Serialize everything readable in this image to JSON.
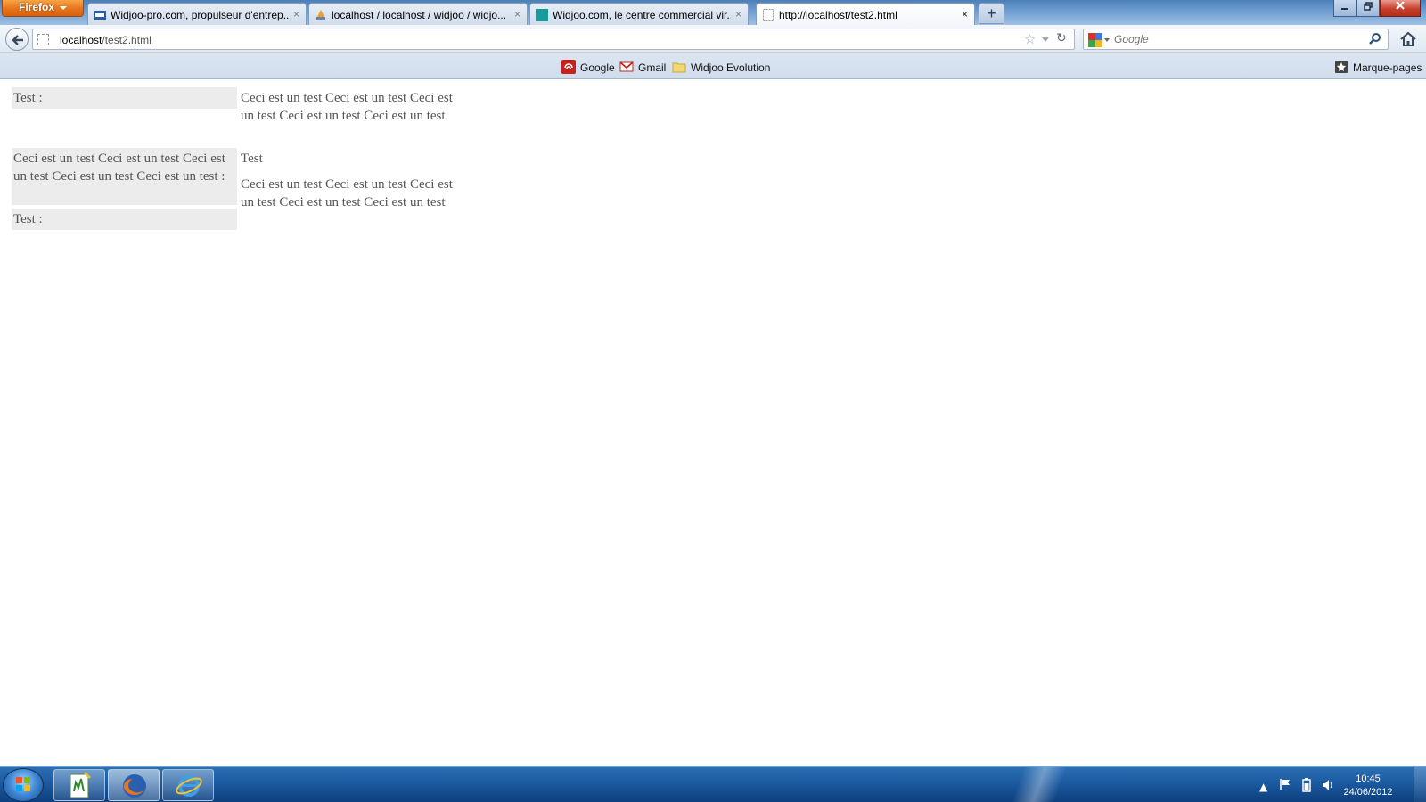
{
  "browser": {
    "menu_button": "Firefox",
    "tabs": [
      {
        "title": "Widjoo-pro.com, propulseur d'entrep...",
        "favicon": "pro-icon"
      },
      {
        "title": "localhost / localhost / widjoo / widjo...",
        "favicon": "phpmyadmin-icon"
      },
      {
        "title": "Widjoo.com, le centre commercial vir...",
        "favicon": "teal-square-icon"
      },
      {
        "title": "http://localhost/test2.html",
        "favicon": "blank-page-icon"
      }
    ],
    "new_tab": "+",
    "close_glyph": "×"
  },
  "navbar": {
    "url_host": "localhost",
    "url_path": "/test2.html",
    "search_placeholder": "Google"
  },
  "bookmarks": {
    "items": [
      {
        "label": "Google",
        "icon": "google-bookmark-icon"
      },
      {
        "label": "Gmail",
        "icon": "gmail-icon"
      },
      {
        "label": "Widjoo Evolution",
        "icon": "folder-icon"
      }
    ],
    "right_label": "Marque-pages"
  },
  "page": {
    "rows": [
      {
        "label": "Test :",
        "value": "Ceci est un test Ceci est un test Ceci est un test Ceci est un test Ceci est un test"
      },
      {
        "label": "Ceci est un test Ceci est un test Ceci est un test Ceci est un test Ceci est un test :",
        "value": "Test"
      },
      {
        "label": "Test :",
        "value": "Ceci est un test Ceci est un test Ceci est un test Ceci est un test Ceci est un test"
      }
    ]
  },
  "taskbar": {
    "time": "10:45",
    "date": "24/06/2012"
  }
}
